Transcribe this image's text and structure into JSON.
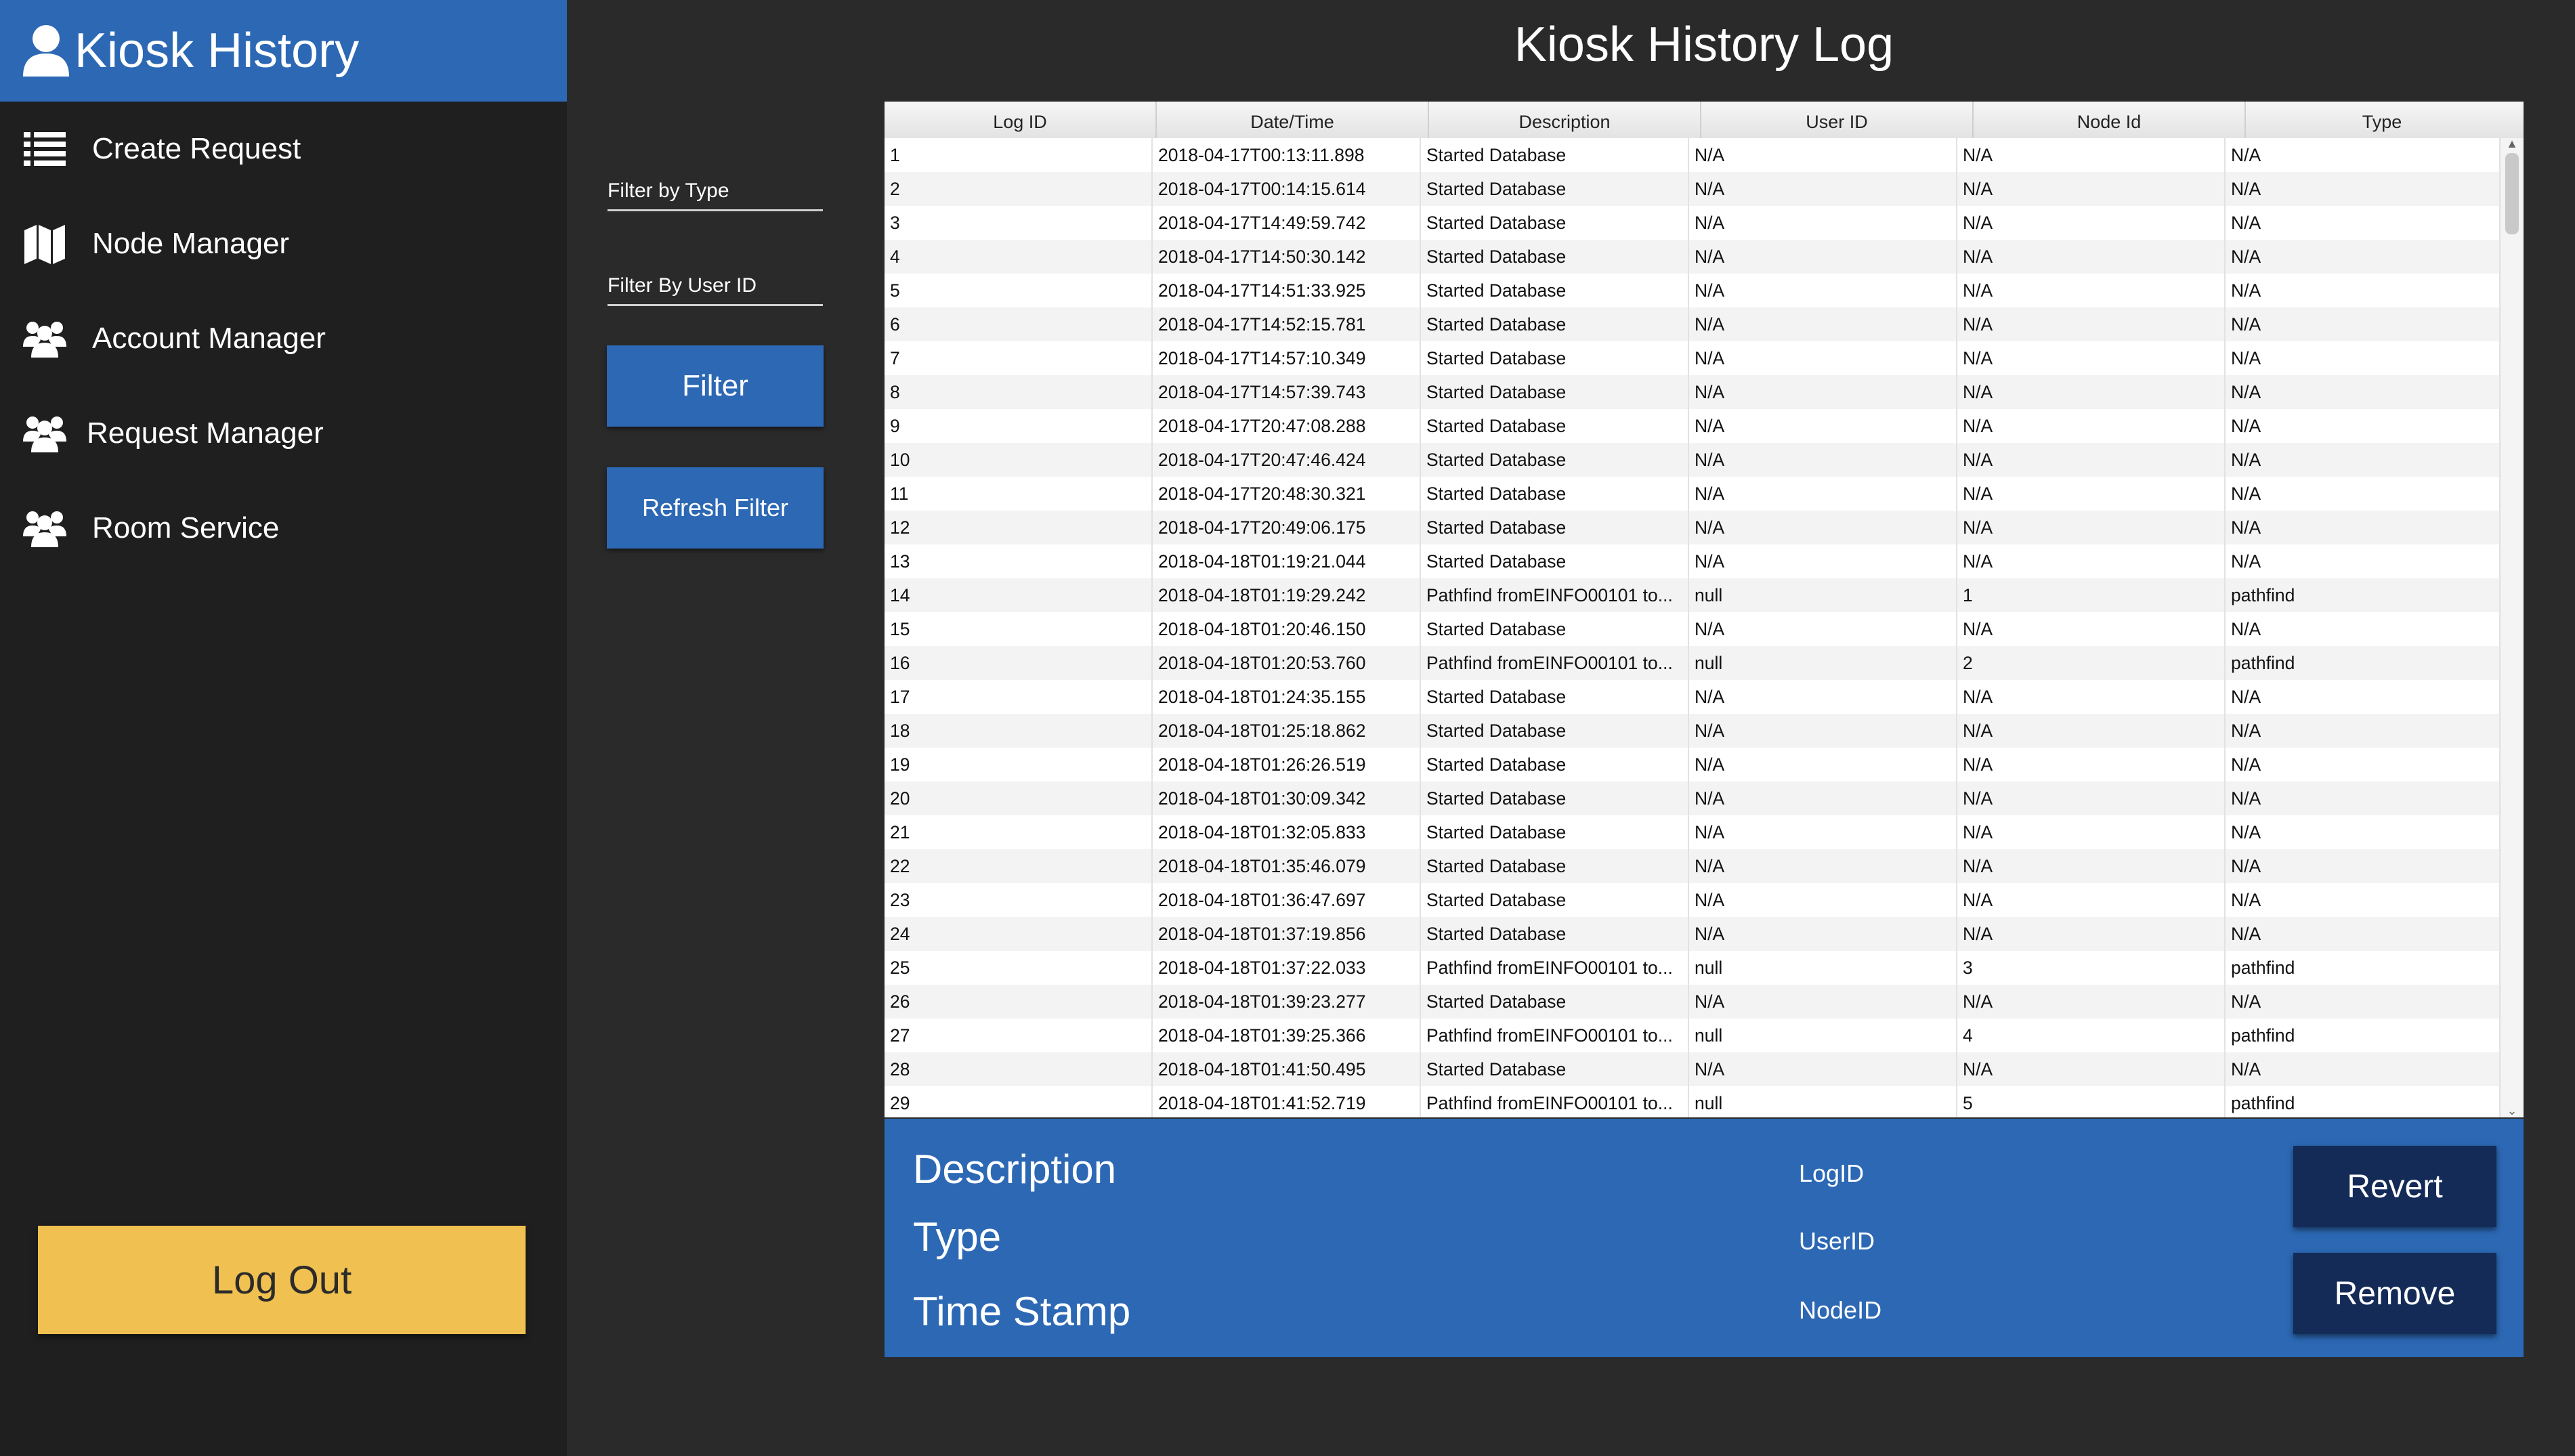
{
  "sidebar": {
    "title": "Kiosk History",
    "items": [
      {
        "label": "Create Request",
        "icon": "list-icon"
      },
      {
        "label": "Node Manager",
        "icon": "map-icon"
      },
      {
        "label": "Account Manager",
        "icon": "users-icon"
      },
      {
        "label": "Request Manager",
        "icon": "users-icon"
      },
      {
        "label": "Room Service",
        "icon": "users-icon"
      }
    ],
    "logout_label": "Log Out"
  },
  "filters": {
    "type_placeholder": "Filter by Type",
    "user_placeholder": "Filter By User ID",
    "filter_label": "Filter",
    "refresh_label": "Refresh Filter"
  },
  "main": {
    "title": "Kiosk History Log"
  },
  "table": {
    "columns": [
      "Log ID",
      "Date/Time",
      "Description",
      "User ID",
      "Node Id",
      "Type"
    ],
    "rows": [
      [
        "1",
        "2018-04-17T00:13:11.898",
        "Started Database",
        "N/A",
        "N/A",
        "N/A"
      ],
      [
        "2",
        "2018-04-17T00:14:15.614",
        "Started Database",
        "N/A",
        "N/A",
        "N/A"
      ],
      [
        "3",
        "2018-04-17T14:49:59.742",
        "Started Database",
        "N/A",
        "N/A",
        "N/A"
      ],
      [
        "4",
        "2018-04-17T14:50:30.142",
        "Started Database",
        "N/A",
        "N/A",
        "N/A"
      ],
      [
        "5",
        "2018-04-17T14:51:33.925",
        "Started Database",
        "N/A",
        "N/A",
        "N/A"
      ],
      [
        "6",
        "2018-04-17T14:52:15.781",
        "Started Database",
        "N/A",
        "N/A",
        "N/A"
      ],
      [
        "7",
        "2018-04-17T14:57:10.349",
        "Started Database",
        "N/A",
        "N/A",
        "N/A"
      ],
      [
        "8",
        "2018-04-17T14:57:39.743",
        "Started Database",
        "N/A",
        "N/A",
        "N/A"
      ],
      [
        "9",
        "2018-04-17T20:47:08.288",
        "Started Database",
        "N/A",
        "N/A",
        "N/A"
      ],
      [
        "10",
        "2018-04-17T20:47:46.424",
        "Started Database",
        "N/A",
        "N/A",
        "N/A"
      ],
      [
        "11",
        "2018-04-17T20:48:30.321",
        "Started Database",
        "N/A",
        "N/A",
        "N/A"
      ],
      [
        "12",
        "2018-04-17T20:49:06.175",
        "Started Database",
        "N/A",
        "N/A",
        "N/A"
      ],
      [
        "13",
        "2018-04-18T01:19:21.044",
        "Started Database",
        "N/A",
        "N/A",
        "N/A"
      ],
      [
        "14",
        "2018-04-18T01:19:29.242",
        "Pathfind fromEINFO00101 to...",
        "null",
        "1",
        "pathfind"
      ],
      [
        "15",
        "2018-04-18T01:20:46.150",
        "Started Database",
        "N/A",
        "N/A",
        "N/A"
      ],
      [
        "16",
        "2018-04-18T01:20:53.760",
        "Pathfind fromEINFO00101 to...",
        "null",
        "2",
        "pathfind"
      ],
      [
        "17",
        "2018-04-18T01:24:35.155",
        "Started Database",
        "N/A",
        "N/A",
        "N/A"
      ],
      [
        "18",
        "2018-04-18T01:25:18.862",
        "Started Database",
        "N/A",
        "N/A",
        "N/A"
      ],
      [
        "19",
        "2018-04-18T01:26:26.519",
        "Started Database",
        "N/A",
        "N/A",
        "N/A"
      ],
      [
        "20",
        "2018-04-18T01:30:09.342",
        "Started Database",
        "N/A",
        "N/A",
        "N/A"
      ],
      [
        "21",
        "2018-04-18T01:32:05.833",
        "Started Database",
        "N/A",
        "N/A",
        "N/A"
      ],
      [
        "22",
        "2018-04-18T01:35:46.079",
        "Started Database",
        "N/A",
        "N/A",
        "N/A"
      ],
      [
        "23",
        "2018-04-18T01:36:47.697",
        "Started Database",
        "N/A",
        "N/A",
        "N/A"
      ],
      [
        "24",
        "2018-04-18T01:37:19.856",
        "Started Database",
        "N/A",
        "N/A",
        "N/A"
      ],
      [
        "25",
        "2018-04-18T01:37:22.033",
        "Pathfind fromEINFO00101 to...",
        "null",
        "3",
        "pathfind"
      ],
      [
        "26",
        "2018-04-18T01:39:23.277",
        "Started Database",
        "N/A",
        "N/A",
        "N/A"
      ],
      [
        "27",
        "2018-04-18T01:39:25.366",
        "Pathfind fromEINFO00101 to...",
        "null",
        "4",
        "pathfind"
      ],
      [
        "28",
        "2018-04-18T01:41:50.495",
        "Started Database",
        "N/A",
        "N/A",
        "N/A"
      ],
      [
        "29",
        "2018-04-18T01:41:52.719",
        "Pathfind fromEINFO00101 to...",
        "null",
        "5",
        "pathfind"
      ]
    ]
  },
  "detail": {
    "description_label": "Description",
    "type_label": "Type",
    "timestamp_label": "Time Stamp",
    "logid_label": "LogID",
    "userid_label": "UserID",
    "nodeid_label": "NodeID",
    "revert_label": "Revert",
    "remove_label": "Remove"
  },
  "colors": {
    "accent_blue": "#2c68b4",
    "dark_button": "#142b58",
    "logout_yellow": "#f0c050",
    "background": "#2a2a2a",
    "sidebar": "#1f1f1f"
  }
}
